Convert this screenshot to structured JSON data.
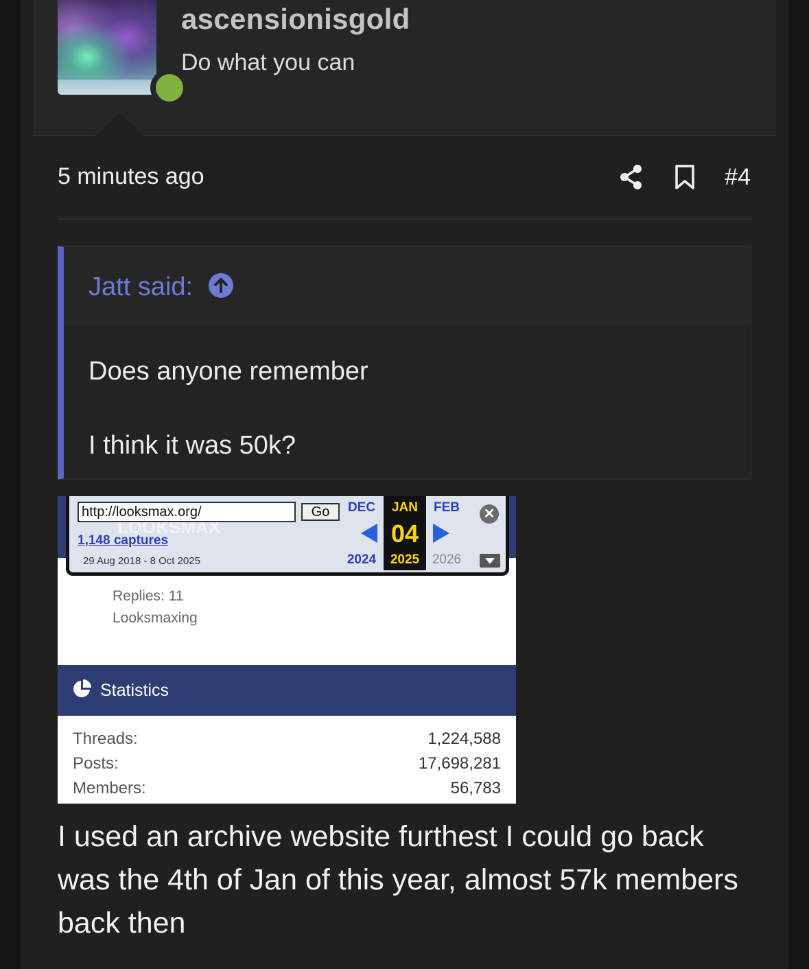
{
  "user": {
    "name": "ascensionisgold",
    "title": "Do what you can",
    "status": "online"
  },
  "post": {
    "time": "5 minutes ago",
    "number": "#4",
    "actions": [
      "share-icon",
      "bookmark-icon"
    ],
    "text": "I used an archive website furthest I could go back was the 4th of Jan of this year, almost 57k members back then"
  },
  "quote": {
    "author": "Jatt said:",
    "lines": [
      "Does anyone remember",
      "I think it was 50k?"
    ]
  },
  "image": {
    "wayback": {
      "url": "http://looksmax.org/",
      "go_label": "Go",
      "captures": "1,148 captures",
      "range": "29 Aug 2018 - 8 Oct 2025",
      "months": [
        "DEC",
        "JAN",
        "FEB"
      ],
      "day": "04",
      "years": [
        "2024",
        "2025",
        "2026"
      ],
      "close": "✕"
    },
    "thread_meta": {
      "replies": "Replies: 11",
      "forum": "Looksmaxing"
    },
    "stats": {
      "title": "Statistics",
      "rows": [
        {
          "label": "Threads:",
          "value": "1,224,588"
        },
        {
          "label": "Posts:",
          "value": "17,698,281"
        },
        {
          "label": "Members:",
          "value": "56,783"
        }
      ]
    }
  },
  "colors": {
    "quote_accent": "#5b63c4",
    "online": "#7fb241",
    "stats_bar": "#2e3d73"
  }
}
